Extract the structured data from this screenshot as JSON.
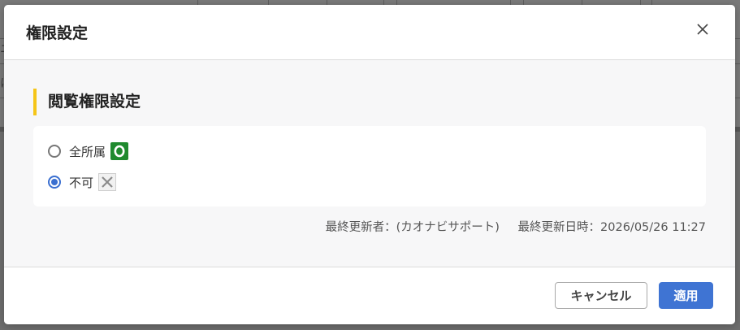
{
  "background": {
    "cut_text_1": "ニ",
    "cut_text_2": "に"
  },
  "dialog": {
    "title": "権限設定",
    "close_icon": "close-icon"
  },
  "section": {
    "heading": "閲覧権限設定",
    "accent_color": "#f5c518"
  },
  "options": [
    {
      "label": "全所属",
      "selected": false,
      "mark": "circle-mark-icon",
      "mark_color": "#1f8a2e"
    },
    {
      "label": "不可",
      "selected": true,
      "mark": "cross-mark-icon",
      "mark_color": "#9a9a9a"
    }
  ],
  "meta": {
    "updated_by": "最終更新者：(カオナビサポート)",
    "updated_at": "最終更新日時：2026/05/26 11:27"
  },
  "footer": {
    "cancel_label": "キャンセル",
    "apply_label": "適用",
    "apply_color": "#3f74d3"
  }
}
